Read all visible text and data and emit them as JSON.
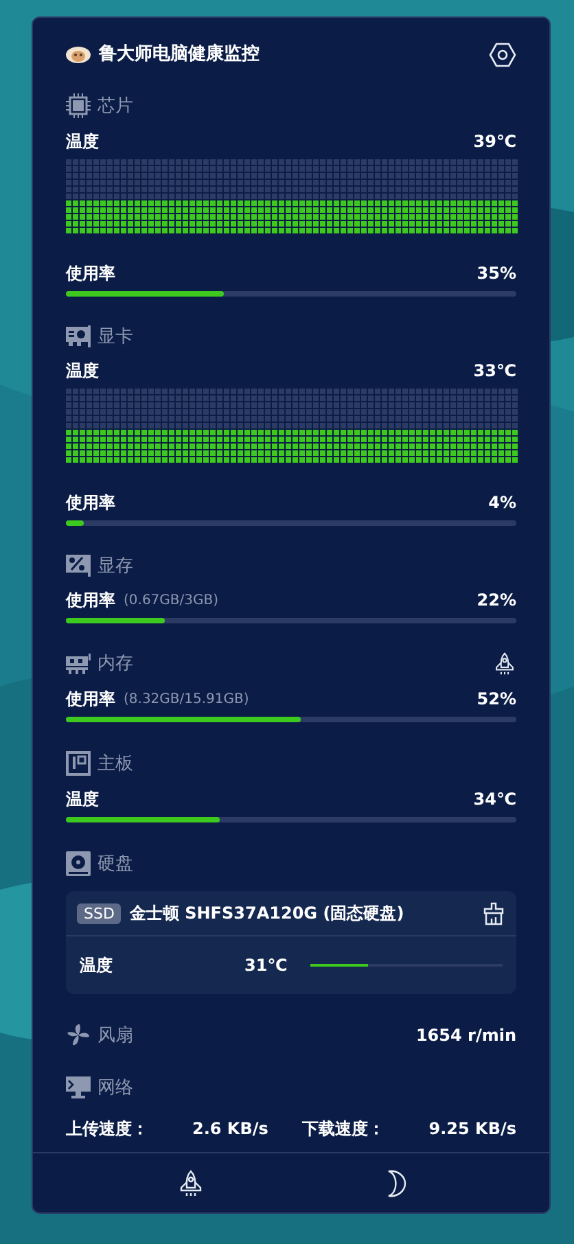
{
  "header": {
    "title": "鲁大师电脑健康监控"
  },
  "sections": [
    {
      "kind": "chip",
      "title": "芯片",
      "metrics": [
        {
          "kind": "dots",
          "label": "温度",
          "value": "39℃"
        },
        {
          "kind": "bar",
          "label": "使用率",
          "value": "35%",
          "level": 0.35
        }
      ]
    },
    {
      "kind": "gpu",
      "title": "显卡",
      "metrics": [
        {
          "kind": "dots",
          "label": "温度",
          "value": "33℃"
        },
        {
          "kind": "bar",
          "label": "使用率",
          "value": "4%",
          "level": 0.04
        }
      ]
    },
    {
      "kind": "vram",
      "title": "显存",
      "metrics": [
        {
          "kind": "bar",
          "label": "使用率",
          "detail": "(0.67GB/3GB)",
          "value": "22%",
          "level": 0.22
        }
      ]
    },
    {
      "kind": "memory",
      "title": "内存",
      "metrics": [
        {
          "kind": "bar",
          "label": "使用率",
          "detail": "(8.32GB/15.91GB)",
          "value": "52%",
          "level": 0.52
        }
      ]
    },
    {
      "kind": "board",
      "title": "主板",
      "metrics": [
        {
          "kind": "bar",
          "label": "温度",
          "value": "34℃",
          "level": 0.34
        }
      ]
    },
    {
      "kind": "disk",
      "title": "硬盘",
      "drives": [
        {
          "badge": "SSD",
          "name": "金士顿 SHFS37A120G (固态硬盘)",
          "label": "温度",
          "value": "31℃",
          "level": 0.3
        }
      ]
    },
    {
      "kind": "fan",
      "title": "风扇",
      "value": "1654 r/min"
    },
    {
      "kind": "network",
      "title": "网络",
      "rates": [
        {
          "label": "上传速度：",
          "value": "2.6 KB/s"
        },
        {
          "label": "下载速度：",
          "value": "9.25 KB/s"
        }
      ]
    }
  ]
}
